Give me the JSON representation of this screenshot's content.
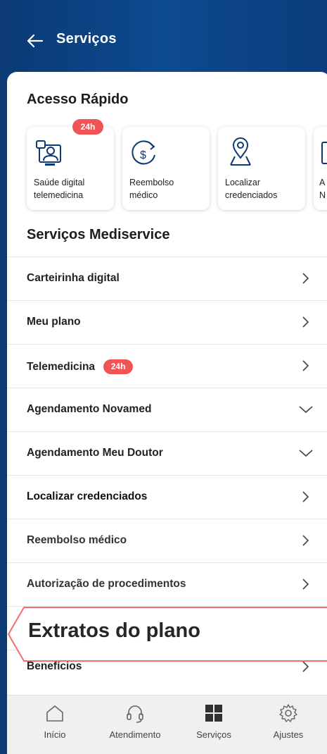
{
  "header": {
    "title": "Serviços"
  },
  "quick_access": {
    "title": "Acesso Rápido",
    "cards": [
      {
        "label_line1": "Saúde digital",
        "label_line2": "telemedicina",
        "badge": "24h",
        "icon": "doctor-screen-icon"
      },
      {
        "label_line1": "Reembolso",
        "label_line2": "médico",
        "icon": "money-refresh-icon"
      },
      {
        "label_line1": "Localizar",
        "label_line2": "credenciados",
        "icon": "map-pin-icon"
      },
      {
        "label_line1": "A",
        "label_line2": "N",
        "icon": "document-icon"
      }
    ]
  },
  "services": {
    "title": "Serviços Mediservice",
    "items": [
      {
        "label": "Carteirinha digital",
        "chevron": "right"
      },
      {
        "label": "Meu plano",
        "chevron": "right"
      },
      {
        "label": "Telemedicina",
        "badge": "24h",
        "chevron": "right"
      },
      {
        "label": "Agendamento Novamed",
        "chevron": "down"
      },
      {
        "label": "Agendamento Meu Doutor",
        "chevron": "down"
      },
      {
        "label": "Localizar credenciados",
        "chevron": "right"
      },
      {
        "label": "Reembolso médico",
        "chevron": "right"
      },
      {
        "label": "Autorização de procedimentos",
        "chevron": "right"
      },
      {
        "label": "Extratos do plano",
        "highlighted": true
      },
      {
        "label": "Benefícios",
        "chevron": "right"
      }
    ]
  },
  "tabbar": {
    "tabs": [
      {
        "label": "Início",
        "icon": "home-icon"
      },
      {
        "label": "Atendimento",
        "icon": "headset-icon"
      },
      {
        "label": "Serviços",
        "icon": "grid-icon",
        "active": true
      },
      {
        "label": "Ajustes",
        "icon": "gear-icon"
      }
    ]
  },
  "colors": {
    "header_bg": "#0b3a75",
    "badge": "#f05454",
    "callout_border": "#f07070"
  }
}
